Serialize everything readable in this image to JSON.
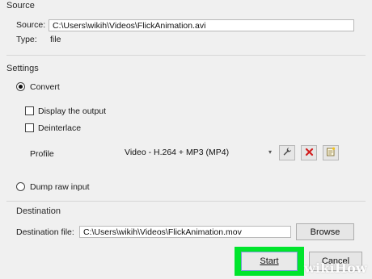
{
  "source_section": {
    "title": "Source",
    "source_label": "Source:",
    "source_value": "C:\\Users\\wikih\\Videos\\FlickAnimation.avi",
    "type_label": "Type:",
    "type_value": "file"
  },
  "settings_section": {
    "title": "Settings",
    "convert_label": "Convert",
    "display_output_label": "Display the output",
    "deinterlace_label": "Deinterlace",
    "profile_label": "Profile",
    "profile_selected": "Video - H.264 + MP3 (MP4)",
    "dump_raw_label": "Dump raw input"
  },
  "destination_section": {
    "title": "Destination",
    "dest_label": "Destination file:",
    "dest_value": "C:\\Users\\wikih\\Videos\\FlickAnimation.mov",
    "browse_label": "Browse"
  },
  "actions": {
    "start_label": "Start",
    "cancel_label": "Cancel"
  },
  "watermark": {
    "part1": "wiki",
    "part2": "How"
  },
  "colors": {
    "highlight": "#00e52c",
    "delete_icon": "#d21f1f"
  },
  "icons": {
    "edit_profile": "wrench-icon",
    "delete_profile": "delete-x-icon",
    "new_profile": "new-profile-icon",
    "dropdown": "chevron-down-icon"
  }
}
